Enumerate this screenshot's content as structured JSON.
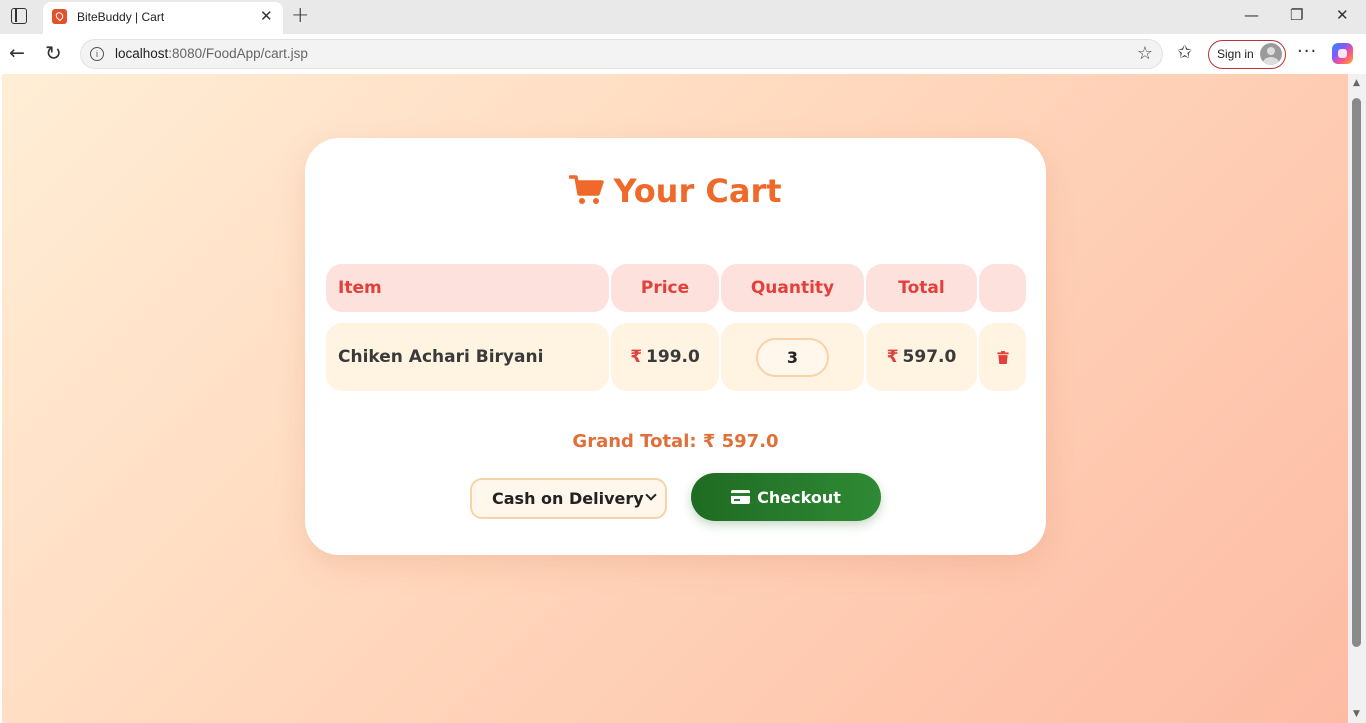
{
  "browser": {
    "tab_title": "BiteBuddy | Cart",
    "url_host": "localhost",
    "url_path": ":8080/FoodApp/cart.jsp",
    "signin_label": "Sign in"
  },
  "cart": {
    "title": "Your Cart",
    "headers": {
      "item": "Item",
      "price": "Price",
      "quantity": "Quantity",
      "total": "Total"
    },
    "items": [
      {
        "name": "Chiken Achari Biryani",
        "currency": "₹",
        "price": "199.0",
        "quantity": "3",
        "total": "597.0"
      }
    ],
    "grand_total_label": "Grand Total: ₹ 597.0",
    "payment_method": "Cash on Delivery",
    "checkout_label": "Checkout"
  },
  "colors": {
    "accent": "#ef6a2a",
    "header_text": "#e2403a",
    "checkout": "#2a7d2e"
  }
}
